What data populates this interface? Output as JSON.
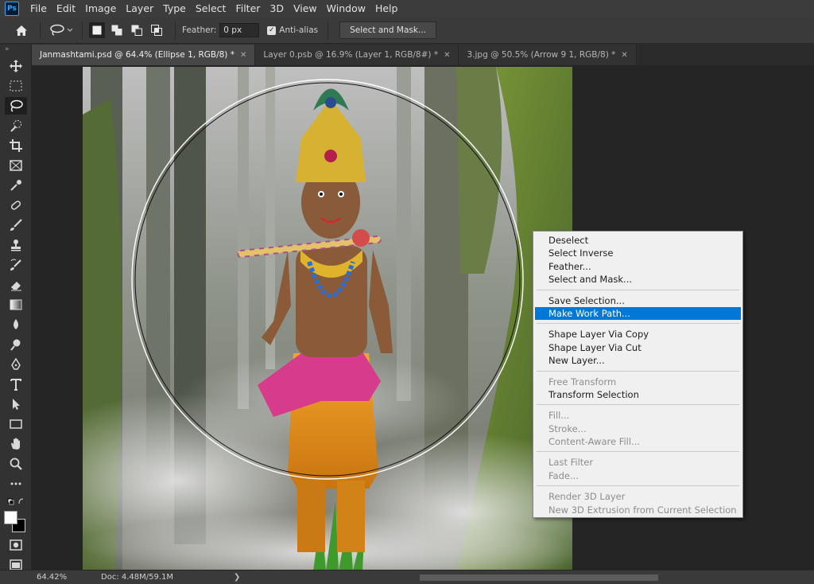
{
  "app": {
    "logo": "Ps"
  },
  "menu": [
    "File",
    "Edit",
    "Image",
    "Layer",
    "Type",
    "Select",
    "Filter",
    "3D",
    "View",
    "Window",
    "Help"
  ],
  "options": {
    "feather_label": "Feather:",
    "feather_value": "0 px",
    "antialias_label": "Anti-alias",
    "antialias_checked": true,
    "select_mask_button": "Select and Mask..."
  },
  "toolbar": {
    "collapse": "»"
  },
  "tabs": [
    {
      "label": "Janmashtami.psd @ 64.4% (Ellipse 1, RGB/8) *",
      "active": true
    },
    {
      "label": "Layer 0.psb @ 16.9% (Layer 1, RGB/8#) *",
      "active": false
    },
    {
      "label": "3.jpg @ 50.5% (Arrow 9 1, RGB/8) *",
      "active": false
    }
  ],
  "context_menu": {
    "groups": [
      [
        {
          "label": "Deselect"
        },
        {
          "label": "Select Inverse"
        },
        {
          "label": "Feather..."
        },
        {
          "label": "Select and Mask..."
        }
      ],
      [
        {
          "label": "Save Selection..."
        },
        {
          "label": "Make Work Path...",
          "highlighted": true
        }
      ],
      [
        {
          "label": "Shape Layer Via Copy"
        },
        {
          "label": "Shape Layer Via Cut"
        },
        {
          "label": "New Layer..."
        }
      ],
      [
        {
          "label": "Free Transform",
          "disabled": true
        },
        {
          "label": "Transform Selection"
        }
      ],
      [
        {
          "label": "Fill...",
          "disabled": true
        },
        {
          "label": "Stroke...",
          "disabled": true
        },
        {
          "label": "Content-Aware Fill...",
          "disabled": true
        }
      ],
      [
        {
          "label": "Last Filter",
          "disabled": true
        },
        {
          "label": "Fade...",
          "disabled": true
        }
      ],
      [
        {
          "label": "Render 3D Layer",
          "disabled": true
        },
        {
          "label": "New 3D Extrusion from Current Selection",
          "disabled": true
        }
      ]
    ]
  },
  "status": {
    "zoom": "64.42%",
    "doc": "Doc: 4.48M/59.1M",
    "arrow": "❯"
  },
  "colors": {
    "highlight": "#0078d7",
    "panel": "#323232",
    "canvas_bg": "#252525"
  }
}
